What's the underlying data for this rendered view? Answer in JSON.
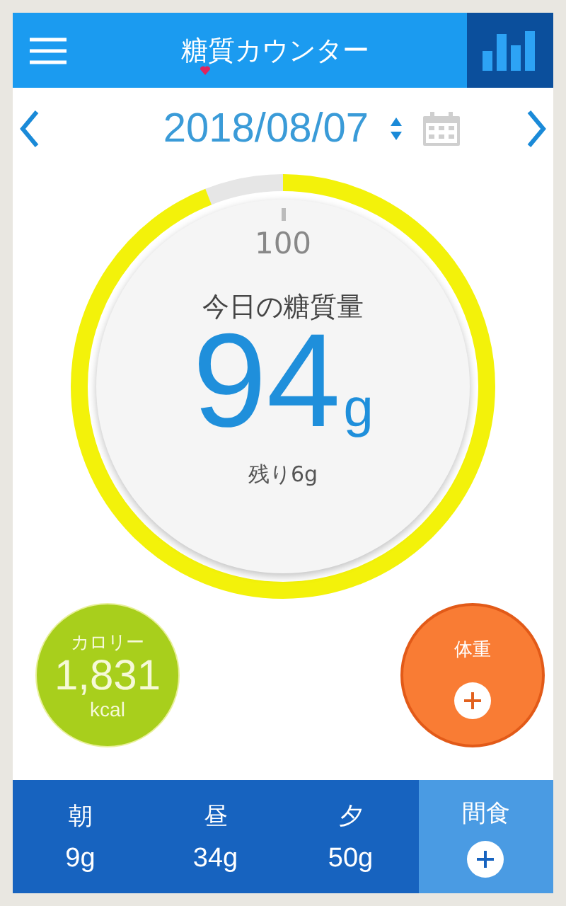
{
  "header": {
    "title": "糖質カウンター"
  },
  "date": {
    "value": "2018/08/07"
  },
  "gauge": {
    "max": "100",
    "label": "今日の糖質量",
    "value": "94",
    "unit": "g",
    "remaining": "残り6g",
    "level": 0.94
  },
  "calories": {
    "label": "カロリー",
    "value": "1,831",
    "unit": "kcal"
  },
  "weight": {
    "label": "体重"
  },
  "meals": [
    {
      "kind": "amount",
      "label": "朝",
      "amount": "9g"
    },
    {
      "kind": "amount",
      "label": "昼",
      "amount": "34g"
    },
    {
      "kind": "amount",
      "label": "夕",
      "amount": "50g"
    },
    {
      "kind": "add",
      "label": "間食"
    }
  ]
}
